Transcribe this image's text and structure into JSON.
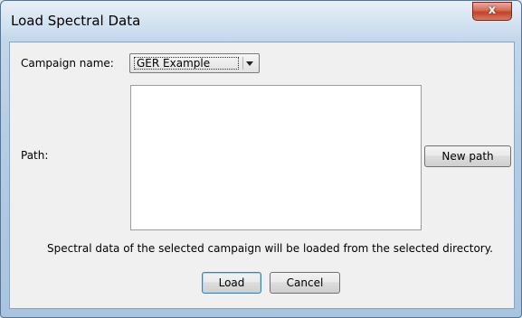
{
  "window": {
    "title": "Load Spectral Data",
    "close_glyph": "x"
  },
  "form": {
    "campaign_label": "Campaign name:",
    "campaign_value": "GER Example",
    "path_label": "Path:",
    "path_value": "",
    "new_path_label": "New path",
    "info_text": "Spectral data of the selected campaign will be loaded from the selected directory."
  },
  "actions": {
    "load_label": "Load",
    "cancel_label": "Cancel"
  },
  "icons": {
    "combo_arrow": "chevron-down-icon",
    "close": "close-icon"
  },
  "colors": {
    "close_button": "#c2412a",
    "client_bg": "#f0f0f0"
  }
}
